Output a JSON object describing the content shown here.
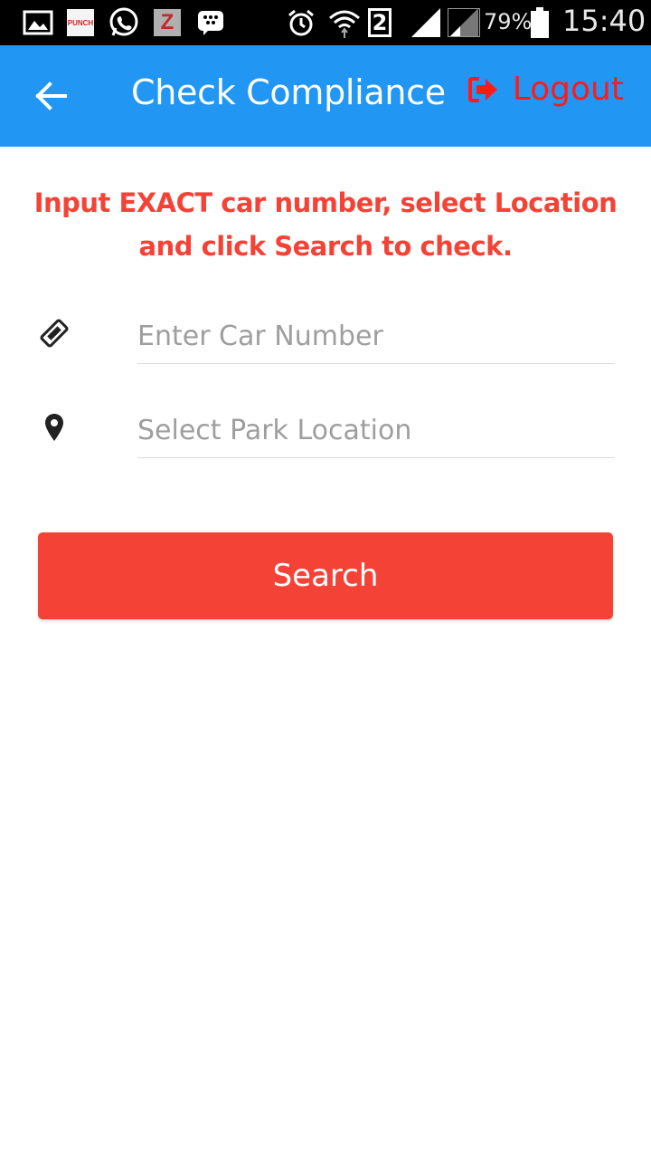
{
  "status_bar": {
    "battery": "79%",
    "time": "15:40",
    "sim_badge": "2",
    "punch_logo": "PUNCH",
    "z_logo": "Z",
    "icons": [
      "gallery-icon",
      "punch-app-icon",
      "whatsapp-icon",
      "z-app-icon",
      "bbm-icon",
      "alarm-icon",
      "wifi-icon",
      "sim2-icon",
      "signal-icon",
      "signal-icon",
      "battery-icon"
    ]
  },
  "app_bar": {
    "back_icon": "arrow-left-icon",
    "title": "Check Compliance",
    "logout_icon": "sign-out-icon",
    "logout_label": "Logout",
    "color": "#2196F3",
    "logout_color": "#ff1a1a"
  },
  "instruction": "Input EXACT car number, select Location and click Search to check.",
  "form": {
    "car_number": {
      "icon": "ticket-icon",
      "placeholder": "Enter Car Number",
      "value": ""
    },
    "park_location": {
      "icon": "map-marker-icon",
      "placeholder": "Select Park Location",
      "value": ""
    }
  },
  "search_button": {
    "label": "Search",
    "color": "#f44336"
  }
}
